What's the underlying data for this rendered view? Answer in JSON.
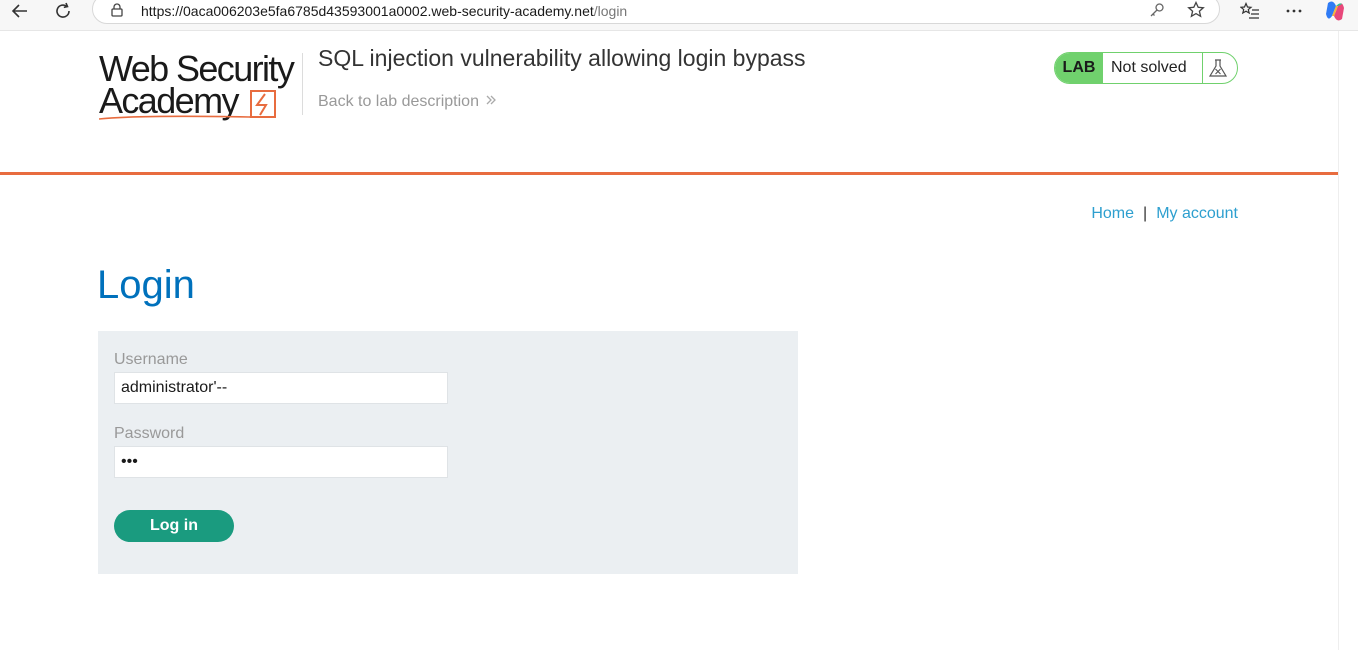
{
  "browser": {
    "url_host": "https://0aca006203e5fa6785d43593001a0002.web-security-academy.net",
    "url_path": "/login"
  },
  "header": {
    "logo_line1": "Web Security",
    "logo_line2": "Academy",
    "lab_title": "SQL injection vulnerability allowing login bypass",
    "back_link": "Back to lab description",
    "status_tag": "LAB",
    "status_text": "Not solved",
    "accent_color": "#e86c3f",
    "status_color": "#70d16d"
  },
  "nav": {
    "home": "Home",
    "separator": "|",
    "my_account": "My account"
  },
  "login": {
    "title": "Login",
    "username_label": "Username",
    "username_value": "administrator'--",
    "password_label": "Password",
    "password_value": "abc",
    "submit_label": "Log in"
  }
}
